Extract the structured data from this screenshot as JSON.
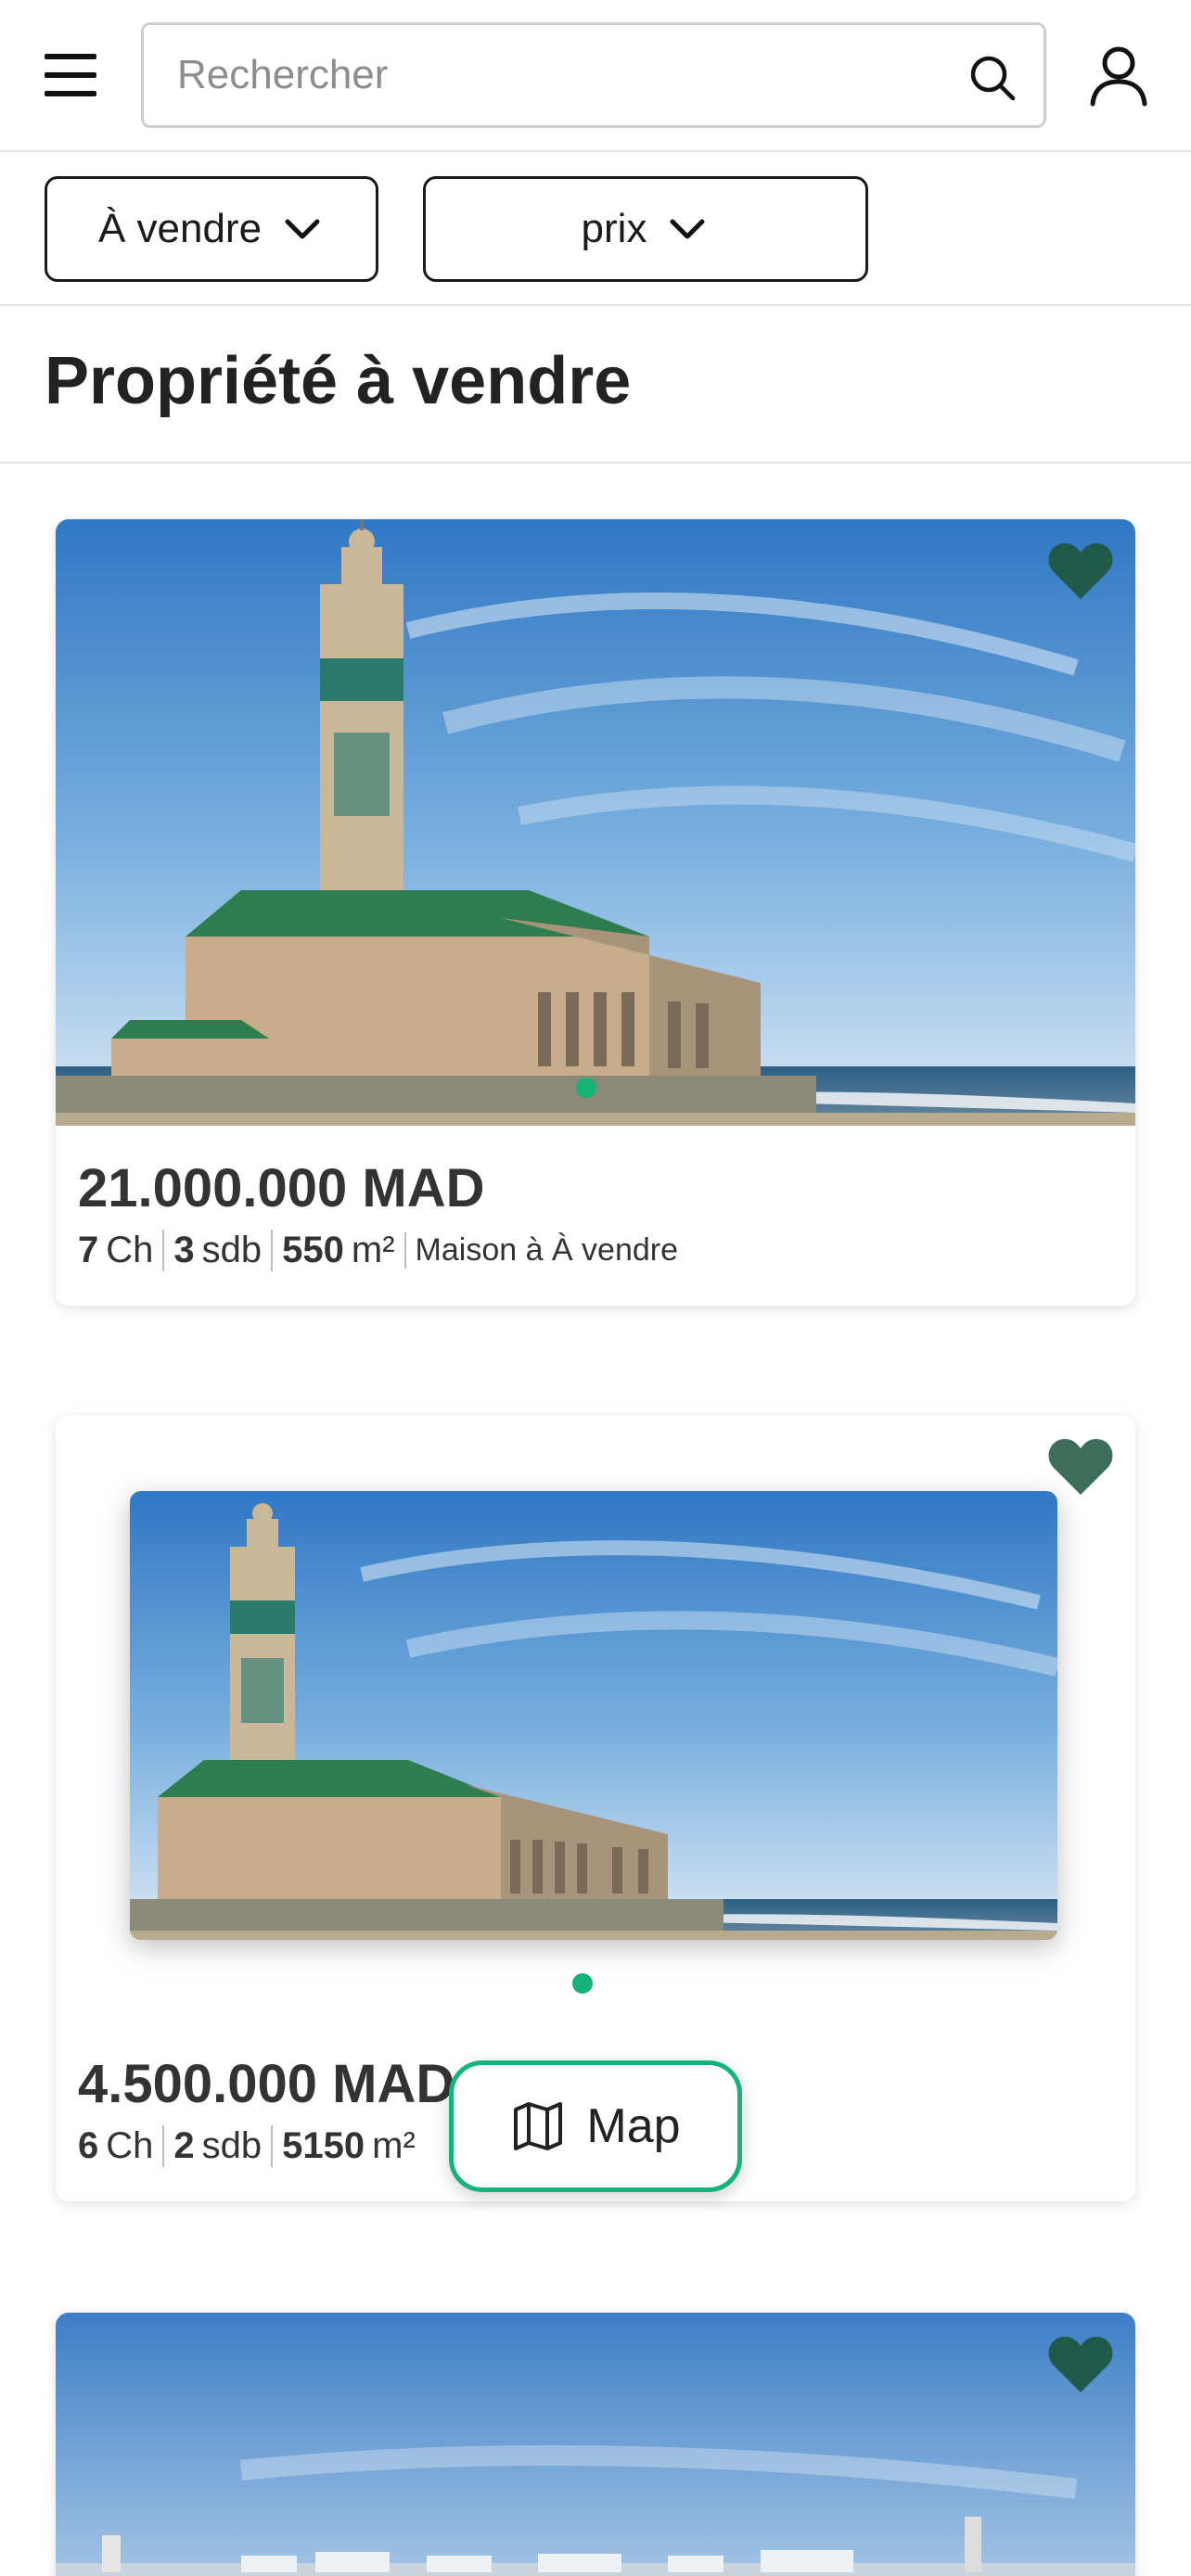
{
  "header": {
    "search_placeholder": "Rechercher",
    "menu_icon": "menu-icon",
    "search_icon": "search-icon",
    "user_icon": "user-icon"
  },
  "filters": [
    {
      "label": "À vendre",
      "icon": "chevron-down-icon"
    },
    {
      "label": "prix",
      "icon": "chevron-down-icon"
    }
  ],
  "page_title": "Propriété à vendre",
  "listings": [
    {
      "price": "21.000.000 MAD",
      "bedrooms": "7",
      "bedrooms_unit": "Ch",
      "bathrooms": "3",
      "bathrooms_unit": "sdb",
      "area": "550",
      "area_unit": "m²",
      "type": "Maison à À vendre",
      "favorite": true
    },
    {
      "price": "4.500.000 MAD",
      "bedrooms": "6",
      "bedrooms_unit": "Ch",
      "bathrooms": "2",
      "bathrooms_unit": "sdb",
      "area": "5150",
      "area_unit": "m²",
      "favorite": true
    },
    {
      "favorite": true
    }
  ],
  "map_button": {
    "label": "Map",
    "icon": "map-icon"
  },
  "colors": {
    "accent": "#14b37a",
    "favorite": "#1f5a4a",
    "text": "#222222",
    "border": "#e3e3e3"
  }
}
